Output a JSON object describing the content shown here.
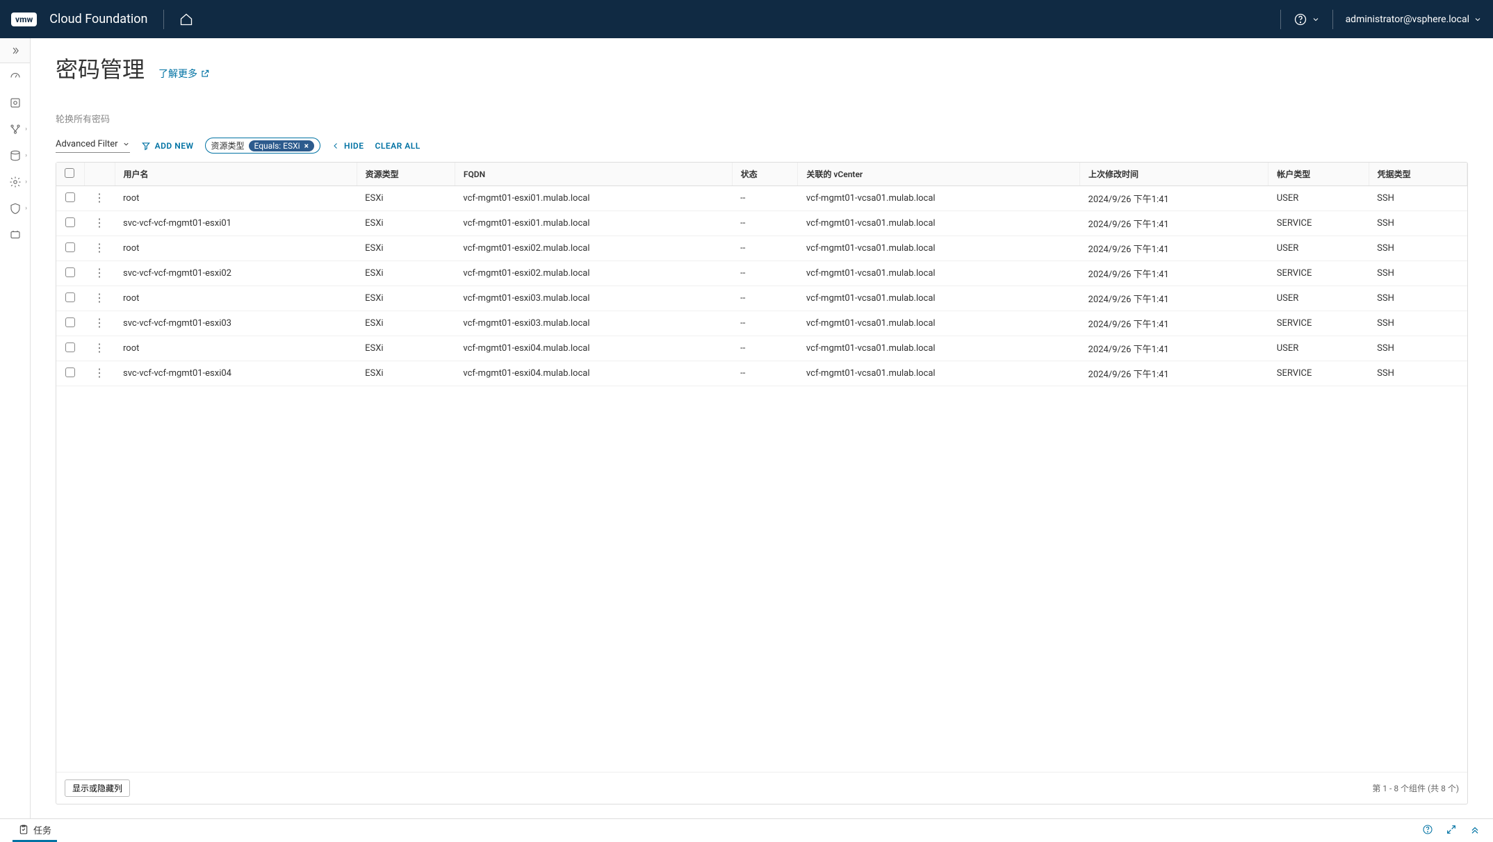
{
  "header": {
    "logo_text": "vmw",
    "product_name": "Cloud Foundation",
    "user": "administrator@vsphere.local"
  },
  "page": {
    "title": "密码管理",
    "learn_more": "了解更多",
    "rotate_all": "轮换所有密码"
  },
  "filters": {
    "advanced_filter": "Advanced Filter",
    "add_new": "ADD NEW",
    "hide": "HIDE",
    "clear_all": "CLEAR ALL",
    "chip_label": "资源类型",
    "chip_value": "Equals: ESXi"
  },
  "table": {
    "headers": {
      "username": "用户名",
      "resource_type": "资源类型",
      "fqdn": "FQDN",
      "status": "状态",
      "associated_vcenter": "关联的 vCenter",
      "last_modified": "上次修改时间",
      "account_type": "帐户类型",
      "credential_type": "凭据类型"
    },
    "rows": [
      {
        "username": "root",
        "resource_type": "ESXi",
        "fqdn": "vcf-mgmt01-esxi01.mulab.local",
        "status": "--",
        "vcenter": "vcf-mgmt01-vcsa01.mulab.local",
        "lastmod": "2024/9/26 下午1:41",
        "account_type": "USER",
        "cred_type": "SSH"
      },
      {
        "username": "svc-vcf-vcf-mgmt01-esxi01",
        "resource_type": "ESXi",
        "fqdn": "vcf-mgmt01-esxi01.mulab.local",
        "status": "--",
        "vcenter": "vcf-mgmt01-vcsa01.mulab.local",
        "lastmod": "2024/9/26 下午1:41",
        "account_type": "SERVICE",
        "cred_type": "SSH"
      },
      {
        "username": "root",
        "resource_type": "ESXi",
        "fqdn": "vcf-mgmt01-esxi02.mulab.local",
        "status": "--",
        "vcenter": "vcf-mgmt01-vcsa01.mulab.local",
        "lastmod": "2024/9/26 下午1:41",
        "account_type": "USER",
        "cred_type": "SSH"
      },
      {
        "username": "svc-vcf-vcf-mgmt01-esxi02",
        "resource_type": "ESXi",
        "fqdn": "vcf-mgmt01-esxi02.mulab.local",
        "status": "--",
        "vcenter": "vcf-mgmt01-vcsa01.mulab.local",
        "lastmod": "2024/9/26 下午1:41",
        "account_type": "SERVICE",
        "cred_type": "SSH"
      },
      {
        "username": "root",
        "resource_type": "ESXi",
        "fqdn": "vcf-mgmt01-esxi03.mulab.local",
        "status": "--",
        "vcenter": "vcf-mgmt01-vcsa01.mulab.local",
        "lastmod": "2024/9/26 下午1:41",
        "account_type": "USER",
        "cred_type": "SSH"
      },
      {
        "username": "svc-vcf-vcf-mgmt01-esxi03",
        "resource_type": "ESXi",
        "fqdn": "vcf-mgmt01-esxi03.mulab.local",
        "status": "--",
        "vcenter": "vcf-mgmt01-vcsa01.mulab.local",
        "lastmod": "2024/9/26 下午1:41",
        "account_type": "SERVICE",
        "cred_type": "SSH"
      },
      {
        "username": "root",
        "resource_type": "ESXi",
        "fqdn": "vcf-mgmt01-esxi04.mulab.local",
        "status": "--",
        "vcenter": "vcf-mgmt01-vcsa01.mulab.local",
        "lastmod": "2024/9/26 下午1:41",
        "account_type": "USER",
        "cred_type": "SSH"
      },
      {
        "username": "svc-vcf-vcf-mgmt01-esxi04",
        "resource_type": "ESXi",
        "fqdn": "vcf-mgmt01-esxi04.mulab.local",
        "status": "--",
        "vcenter": "vcf-mgmt01-vcsa01.mulab.local",
        "lastmod": "2024/9/26 下午1:41",
        "account_type": "SERVICE",
        "cred_type": "SSH"
      }
    ],
    "footer": {
      "columns_btn": "显示或隐藏列",
      "pagination": "第 1 - 8 个组件 (共 8 个)"
    }
  },
  "bottom": {
    "tasks": "任务"
  }
}
